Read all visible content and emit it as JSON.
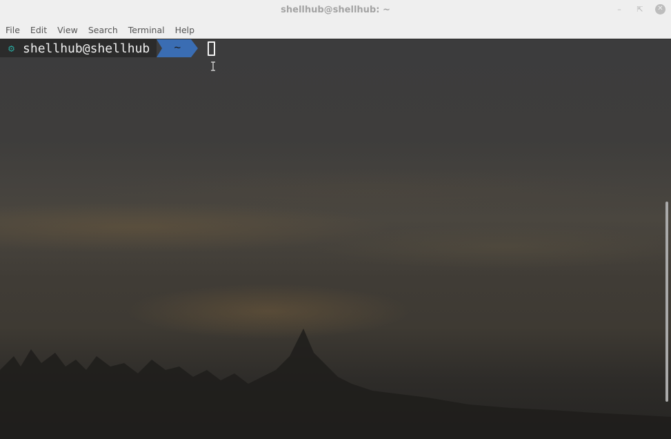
{
  "window": {
    "title": "shellhub@shellhub: ~",
    "controls": {
      "minimize": "minimize-icon",
      "maximize": "maximize-icon",
      "close": "close-icon"
    }
  },
  "menubar": {
    "items": [
      "File",
      "Edit",
      "View",
      "Search",
      "Terminal",
      "Help"
    ]
  },
  "terminal": {
    "prompt_user": "shellhub@shellhub",
    "prompt_dir": "~",
    "prompt_icon": "gear-icon"
  },
  "colors": {
    "prompt_accent": "#2aa198",
    "dir_segment": "#3a6db3",
    "titlebar": "#efefef"
  }
}
